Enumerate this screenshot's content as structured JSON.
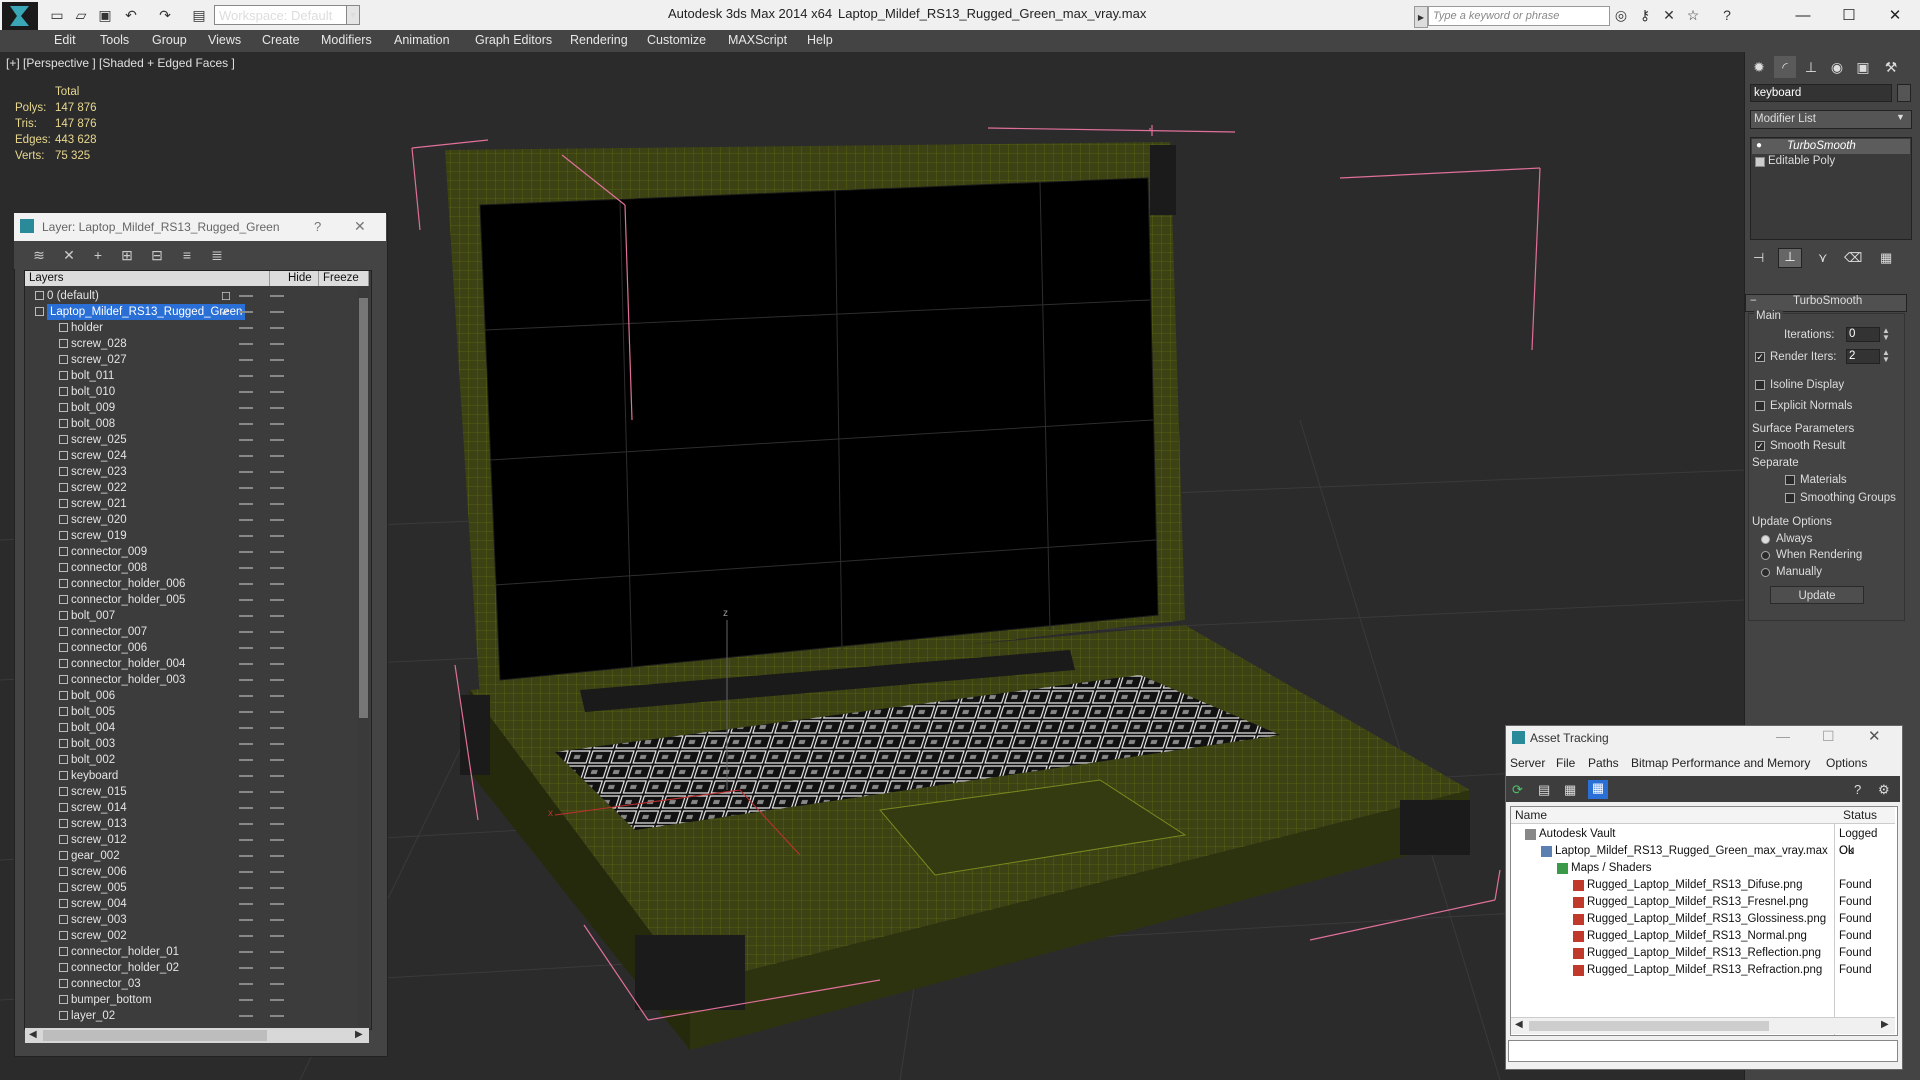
{
  "titlebar": {
    "workspace": "Workspace: Default",
    "app_title": "Autodesk 3ds Max  2014 x64",
    "file_title": "Laptop_Mildef_RS13_Rugged_Green_max_vray.max",
    "search_placeholder": "Type a keyword or phrase"
  },
  "menu": [
    "Edit",
    "Tools",
    "Group",
    "Views",
    "Create",
    "Modifiers",
    "Animation",
    "Graph Editors",
    "Rendering",
    "Customize",
    "MAXScript",
    "Help"
  ],
  "viewport": {
    "label": "[+] [Perspective ] [Shaded + Edged Faces ]",
    "stats_header": "Total",
    "stats": [
      {
        "label": "Polys:",
        "value": "147 876"
      },
      {
        "label": "Tris:",
        "value": "147 876"
      },
      {
        "label": "Edges:",
        "value": "443 628"
      },
      {
        "label": "Verts:",
        "value": "75 325"
      }
    ],
    "axis_z": "z",
    "axis_x": "x"
  },
  "layer_panel": {
    "title": "Layer: Laptop_Mildef_RS13_Rugged_Green",
    "help": "?",
    "close": "✕",
    "col_layers": "Layers",
    "col_hide": "Hide",
    "col_freeze": "Freeze",
    "rows": [
      {
        "name": "0 (default)",
        "level": 0
      },
      {
        "name": "Laptop_Mildef_RS13_Rugged_Green",
        "level": 0,
        "selected": true
      },
      {
        "name": "holder",
        "level": 1
      },
      {
        "name": "screw_028",
        "level": 1
      },
      {
        "name": "screw_027",
        "level": 1
      },
      {
        "name": "bolt_011",
        "level": 1
      },
      {
        "name": "bolt_010",
        "level": 1
      },
      {
        "name": "bolt_009",
        "level": 1
      },
      {
        "name": "bolt_008",
        "level": 1
      },
      {
        "name": "screw_025",
        "level": 1
      },
      {
        "name": "screw_024",
        "level": 1
      },
      {
        "name": "screw_023",
        "level": 1
      },
      {
        "name": "screw_022",
        "level": 1
      },
      {
        "name": "screw_021",
        "level": 1
      },
      {
        "name": "screw_020",
        "level": 1
      },
      {
        "name": "screw_019",
        "level": 1
      },
      {
        "name": "connector_009",
        "level": 1
      },
      {
        "name": "connector_008",
        "level": 1
      },
      {
        "name": "connector_holder_006",
        "level": 1
      },
      {
        "name": "connector_holder_005",
        "level": 1
      },
      {
        "name": "bolt_007",
        "level": 1
      },
      {
        "name": "connector_007",
        "level": 1
      },
      {
        "name": "connector_006",
        "level": 1
      },
      {
        "name": "connector_holder_004",
        "level": 1
      },
      {
        "name": "connector_holder_003",
        "level": 1
      },
      {
        "name": "bolt_006",
        "level": 1
      },
      {
        "name": "bolt_005",
        "level": 1
      },
      {
        "name": "bolt_004",
        "level": 1
      },
      {
        "name": "bolt_003",
        "level": 1
      },
      {
        "name": "bolt_002",
        "level": 1
      },
      {
        "name": "keyboard",
        "level": 1
      },
      {
        "name": "screw_015",
        "level": 1
      },
      {
        "name": "screw_014",
        "level": 1
      },
      {
        "name": "screw_013",
        "level": 1
      },
      {
        "name": "screw_012",
        "level": 1
      },
      {
        "name": "gear_002",
        "level": 1
      },
      {
        "name": "screw_006",
        "level": 1
      },
      {
        "name": "screw_005",
        "level": 1
      },
      {
        "name": "screw_004",
        "level": 1
      },
      {
        "name": "screw_003",
        "level": 1
      },
      {
        "name": "screw_002",
        "level": 1
      },
      {
        "name": "connector_holder_01",
        "level": 1
      },
      {
        "name": "connector_holder_02",
        "level": 1
      },
      {
        "name": "connector_03",
        "level": 1
      },
      {
        "name": "bumper_bottom",
        "level": 1
      },
      {
        "name": "layer_02",
        "level": 1
      }
    ]
  },
  "command_panel": {
    "object_name": "keyboard",
    "modifier_list": "Modifier List",
    "stack": [
      "TurboSmooth",
      "Editable Poly"
    ],
    "rollout_title": "TurboSmooth",
    "main": "Main",
    "iterations_label": "Iterations:",
    "iterations_value": "0",
    "render_iters_label": "Render Iters:",
    "render_iters_value": "2",
    "render_iters_checked": true,
    "isoline": "Isoline Display",
    "explicit": "Explicit Normals",
    "surface": "Surface Parameters",
    "smooth_result": "Smooth Result",
    "smooth_result_checked": true,
    "separate": "Separate",
    "materials": "Materials",
    "smoothing_groups": "Smoothing Groups",
    "update_options": "Update Options",
    "always": "Always",
    "when_rendering": "When Rendering",
    "manually": "Manually",
    "update_button": "Update"
  },
  "asset_tracking": {
    "title": "Asset Tracking",
    "menu": [
      "Server",
      "File",
      "Paths",
      "Bitmap Performance and Memory",
      "Options"
    ],
    "col_name": "Name",
    "col_status": "Status",
    "rows": [
      {
        "name": "Autodesk Vault",
        "status": "Logged Ou",
        "indent": 0,
        "icon": "vault"
      },
      {
        "name": "Laptop_Mildef_RS13_Rugged_Green_max_vray.max",
        "status": "Ok",
        "indent": 1,
        "icon": "max"
      },
      {
        "name": "Maps / Shaders",
        "status": "",
        "indent": 2,
        "icon": "folder"
      },
      {
        "name": "Rugged_Laptop_Mildef_RS13_Difuse.png",
        "status": "Found",
        "indent": 3,
        "icon": "png"
      },
      {
        "name": "Rugged_Laptop_Mildef_RS13_Fresnel.png",
        "status": "Found",
        "indent": 3,
        "icon": "png"
      },
      {
        "name": "Rugged_Laptop_Mildef_RS13_Glossiness.png",
        "status": "Found",
        "indent": 3,
        "icon": "png"
      },
      {
        "name": "Rugged_Laptop_Mildef_RS13_Normal.png",
        "status": "Found",
        "indent": 3,
        "icon": "png"
      },
      {
        "name": "Rugged_Laptop_Mildef_RS13_Reflection.png",
        "status": "Found",
        "indent": 3,
        "icon": "png"
      },
      {
        "name": "Rugged_Laptop_Mildef_RS13_Refraction.png",
        "status": "Found",
        "indent": 3,
        "icon": "png"
      }
    ]
  },
  "colors": {
    "laptop_green": "#3c4214",
    "wire": "#6b7a10",
    "bbox": "#e0709a",
    "stats_text": "#e8d890",
    "selection": "#2a6fd6"
  }
}
